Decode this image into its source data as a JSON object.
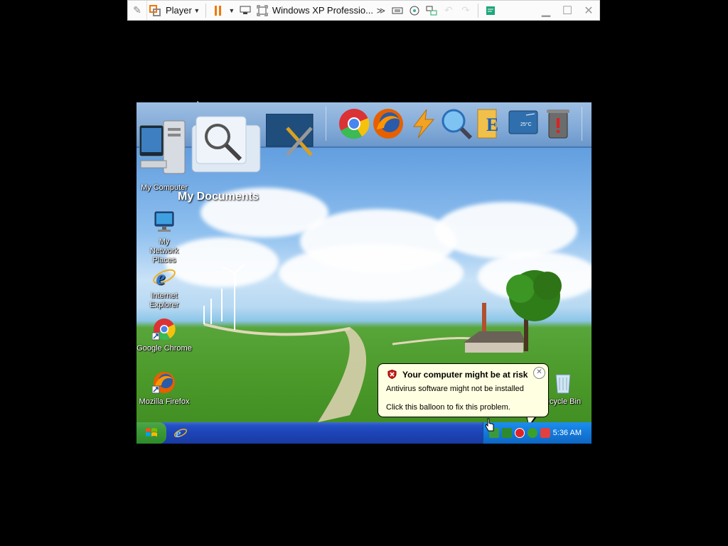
{
  "vmware_toolbar": {
    "player_label": "Player",
    "vm_name": "Windows XP Professio...",
    "more_label": "≫"
  },
  "desktop": {
    "icons": [
      {
        "label": "My Computer"
      },
      {
        "label": "My Network Places"
      },
      {
        "label": "Internet Explorer"
      },
      {
        "label": "Google Chrome"
      },
      {
        "label": "Mozilla Firefox"
      },
      {
        "label": "ecycle Bin"
      }
    ],
    "dock_zoom_label": "My Documents",
    "dock_items": [
      "My Documents",
      "Control Panel",
      "Google Chrome",
      "Mozilla Firefox",
      "Flash",
      "Search",
      "Windows Explorer",
      "Display",
      "Recycle Bin"
    ],
    "dock_display_readout": "25°C"
  },
  "balloon": {
    "title": "Your computer might be at risk",
    "line1": "Antivirus software might not be installed",
    "line2": "Click this balloon to fix this problem.",
    "close_glyph": "✕"
  },
  "taskbar": {
    "clock": "5:36 AM"
  },
  "colors": {
    "taskbar_blue": "#1d43b6",
    "start_green": "#3c9a36",
    "tray_blue": "#1479d8",
    "balloon_bg": "#ffffe1",
    "pause_orange": "#f07800"
  }
}
